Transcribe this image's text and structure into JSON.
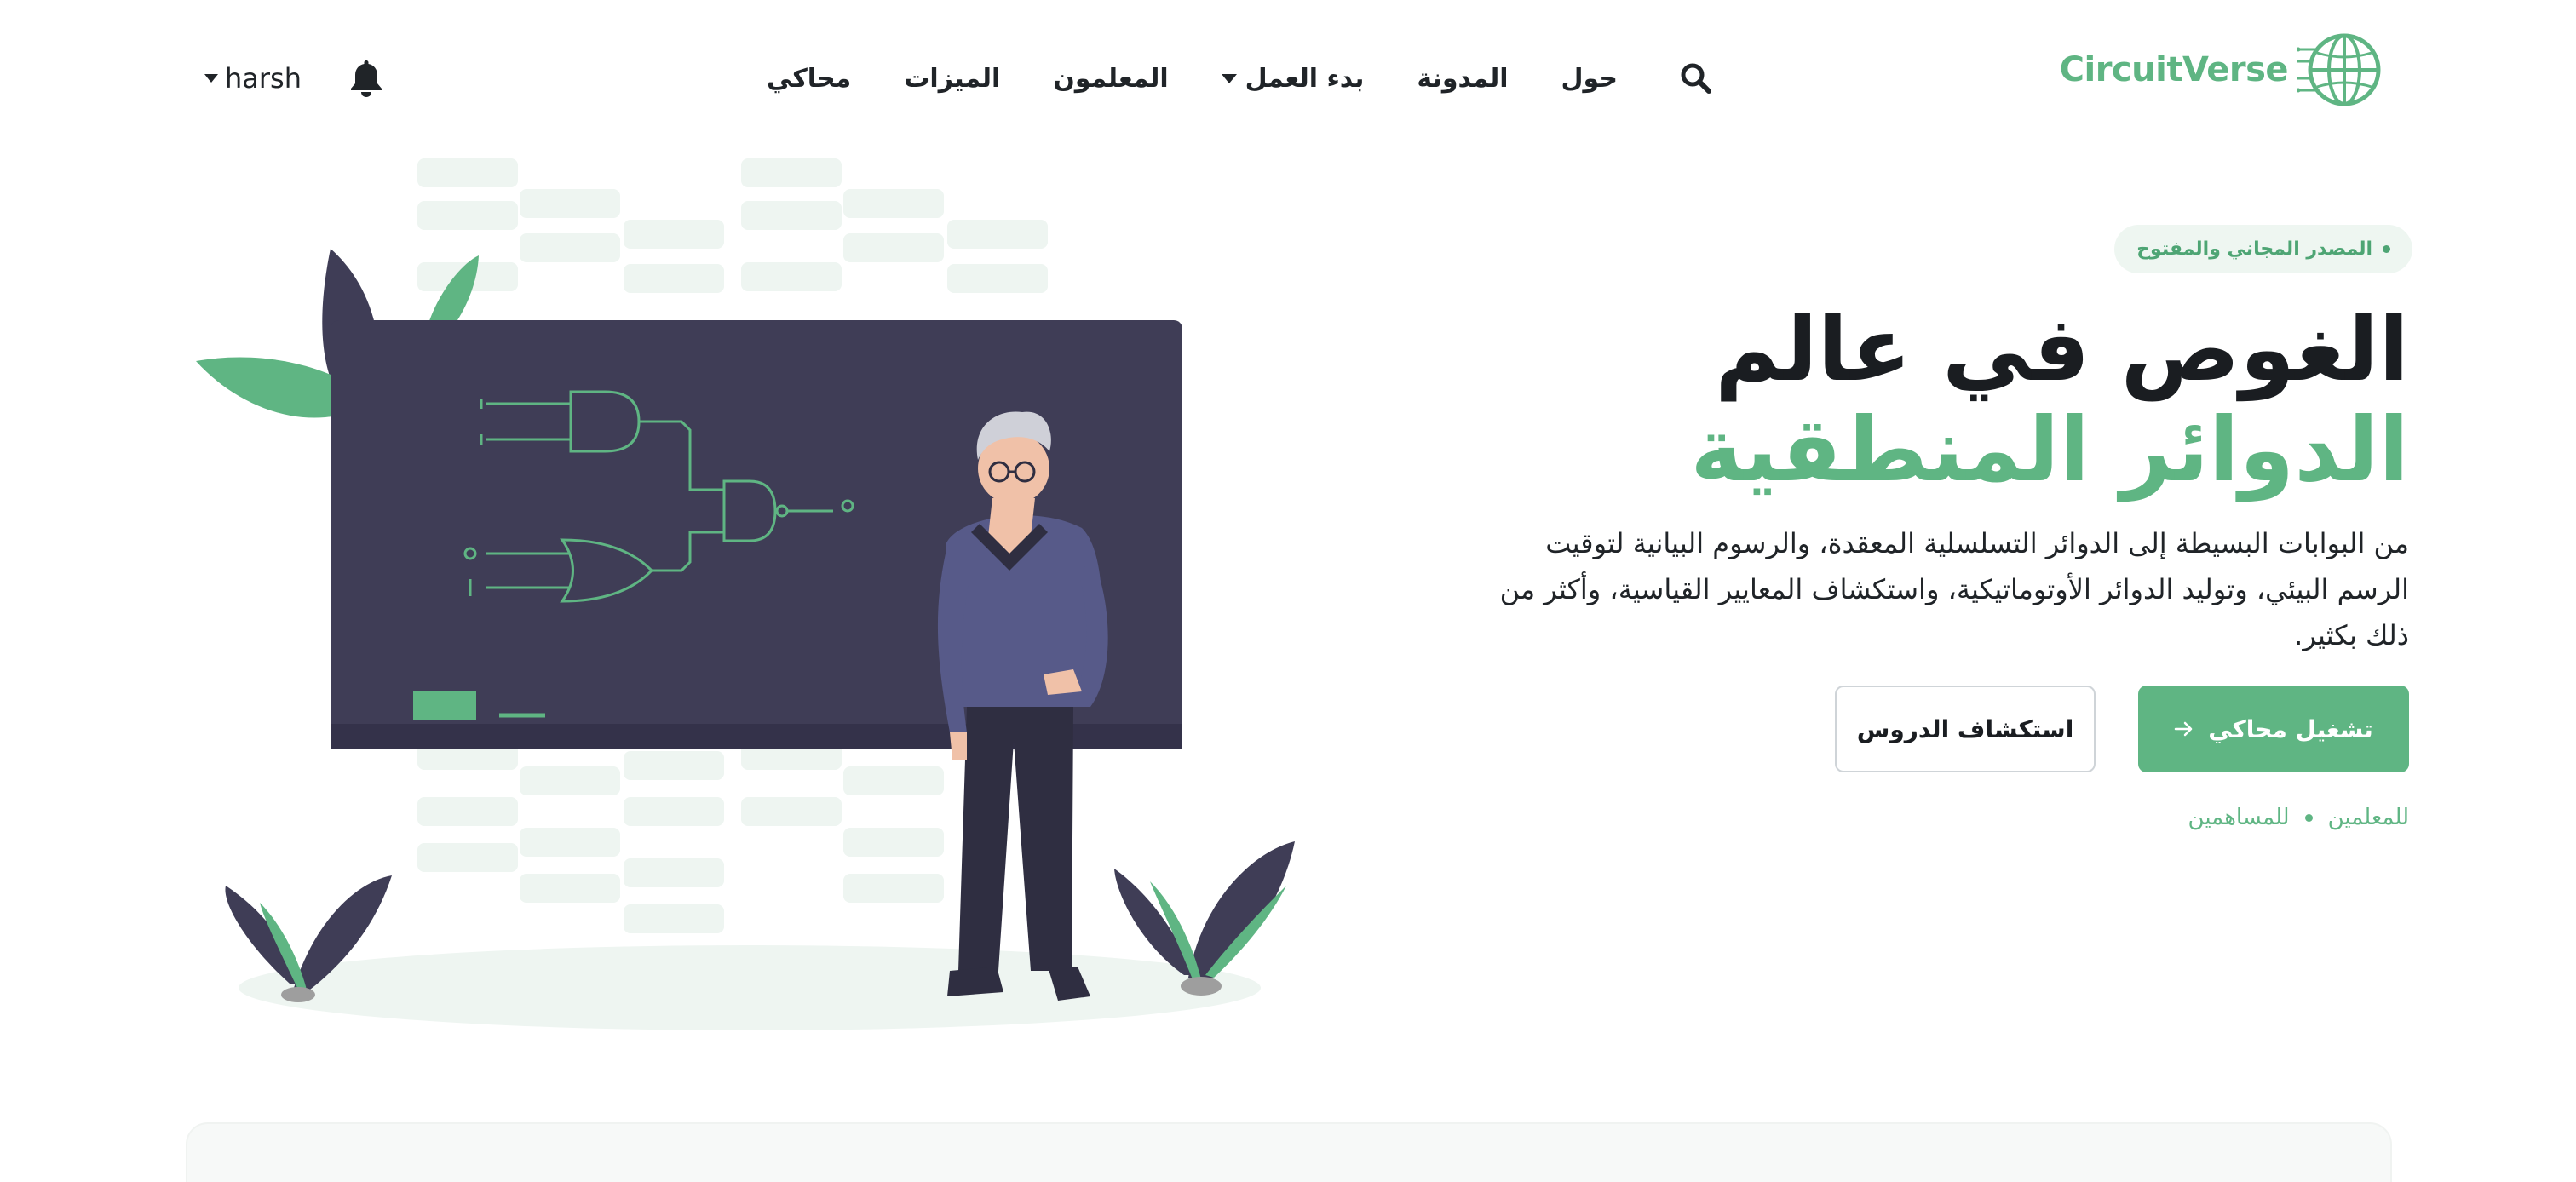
{
  "brand": {
    "name": "CircuitVerse",
    "logo_icon": "circuit-globe-icon",
    "color": "#5fb583"
  },
  "nav": {
    "links": [
      {
        "label": "محاكي",
        "has_dropdown": false
      },
      {
        "label": "الميزات",
        "has_dropdown": false
      },
      {
        "label": "المعلمون",
        "has_dropdown": false
      },
      {
        "label": "بدء العمل",
        "has_dropdown": true
      },
      {
        "label": "المدونة",
        "has_dropdown": false
      },
      {
        "label": "حول",
        "has_dropdown": false
      }
    ],
    "search_icon": "search-icon"
  },
  "user": {
    "name": "harsh",
    "notification_icon": "bell-icon"
  },
  "hero": {
    "tag": "المصدر المجاني والمفتوح",
    "headline_line1": "الغوص في عالم",
    "headline_line2": "الدوائر المنطقية",
    "lead": "من البوابات البسيطة إلى الدوائر التسلسلية المعقدة، والرسوم البيانية لتوقيت الرسم البيئي، وتوليد الدوائر الأوتوماتيكية، واستكشاف المعايير القياسية، وأكثر من ذلك بكثير.",
    "primary_button": "تشغيل محاكي",
    "primary_button_icon": "arrow-right-icon",
    "secondary_button": "استكشاف الدروس",
    "sub_links": [
      "للمعلمين",
      "للمساهمين"
    ]
  },
  "colors": {
    "accent": "#5fb583",
    "dark": "#3f3d56",
    "text": "#1a1d21",
    "tag_bg": "#eef6f1"
  }
}
